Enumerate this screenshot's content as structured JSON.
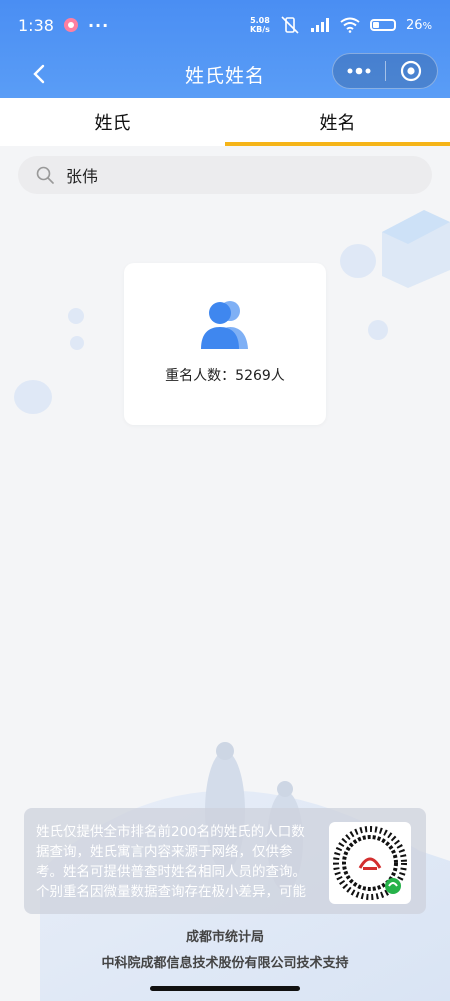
{
  "status": {
    "time": "1:38",
    "overflow": "···",
    "net_speed_value": "5.08",
    "net_speed_unit": "KB/s",
    "battery": "26",
    "battery_suffix": "%"
  },
  "nav": {
    "title": "姓氏姓名",
    "back_icon": "chevron-left-icon",
    "more_icon": "more-dots-icon",
    "close_icon": "target-circle-icon"
  },
  "tabs": [
    {
      "label": "姓氏",
      "active": false
    },
    {
      "label": "姓名",
      "active": true
    }
  ],
  "search": {
    "value": "张伟",
    "icon": "search-icon"
  },
  "result": {
    "icon": "users-icon",
    "label": "重名人数：5269人"
  },
  "notice": {
    "text": "姓氏仅提供全市排名前200名的姓氏的人口数据查询，姓氏寓言内容来源于网络，仅供参考。姓名可提供普查时姓名相同人员的查询。个别重名因微量数据查询存在极小差异，可能出现数据不可查或有出入的情况"
  },
  "footer": {
    "line1": "成都市统计局",
    "line2": "中科院成都信息技术股份有限公司技术支持"
  },
  "colors": {
    "header": "#4a8ef3",
    "tab_indicator": "#f5b418",
    "icon_blue": "#3f87ef"
  }
}
